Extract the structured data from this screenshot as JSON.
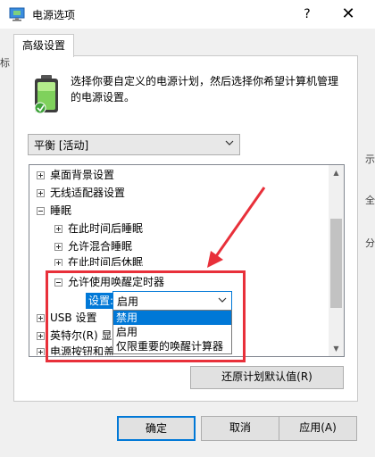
{
  "window": {
    "title": "电源选项",
    "help_glyph": "?",
    "close_glyph": "✕"
  },
  "tab": {
    "label": "高级设置"
  },
  "description": "选择你要自定义的电源计划，然后选择你希望计算机管理的电源设置。",
  "plan_select": {
    "value": "平衡 [活动]"
  },
  "tree": {
    "items": [
      {
        "label": "桌面背景设置",
        "expander": "plus"
      },
      {
        "label": "无线适配器设置",
        "expander": "plus"
      },
      {
        "label": "睡眠",
        "expander": "minus"
      },
      {
        "label": "在此时间后睡眠",
        "expander": "plus"
      },
      {
        "label": "允许混合睡眠",
        "expander": "plus"
      },
      {
        "label": "在此时间后休眠",
        "expander": "plus"
      },
      {
        "label": "允许使用唤醒定时器",
        "expander": "minus"
      },
      {
        "label": "USB 设置",
        "expander": "plus"
      },
      {
        "label": "英特尔(R) 显",
        "expander": "plus"
      },
      {
        "label": "电源按钮和盖",
        "expander": "plus"
      }
    ],
    "setting_label": "设置:",
    "setting_value": "启用",
    "dropdown_options": [
      "禁用",
      "启用",
      "仅限重要的唤醒计算器"
    ],
    "selected_option_index": 0
  },
  "buttons": {
    "restore": "还原计划默认值(R)",
    "ok": "确定",
    "cancel": "取消",
    "apply": "应用(A)"
  },
  "background_fragments": {
    "left_char": "标",
    "right_chars": [
      "示",
      "全",
      "分"
    ]
  },
  "colors": {
    "accent": "#0078d7",
    "annotation_red": "#e8303a"
  }
}
